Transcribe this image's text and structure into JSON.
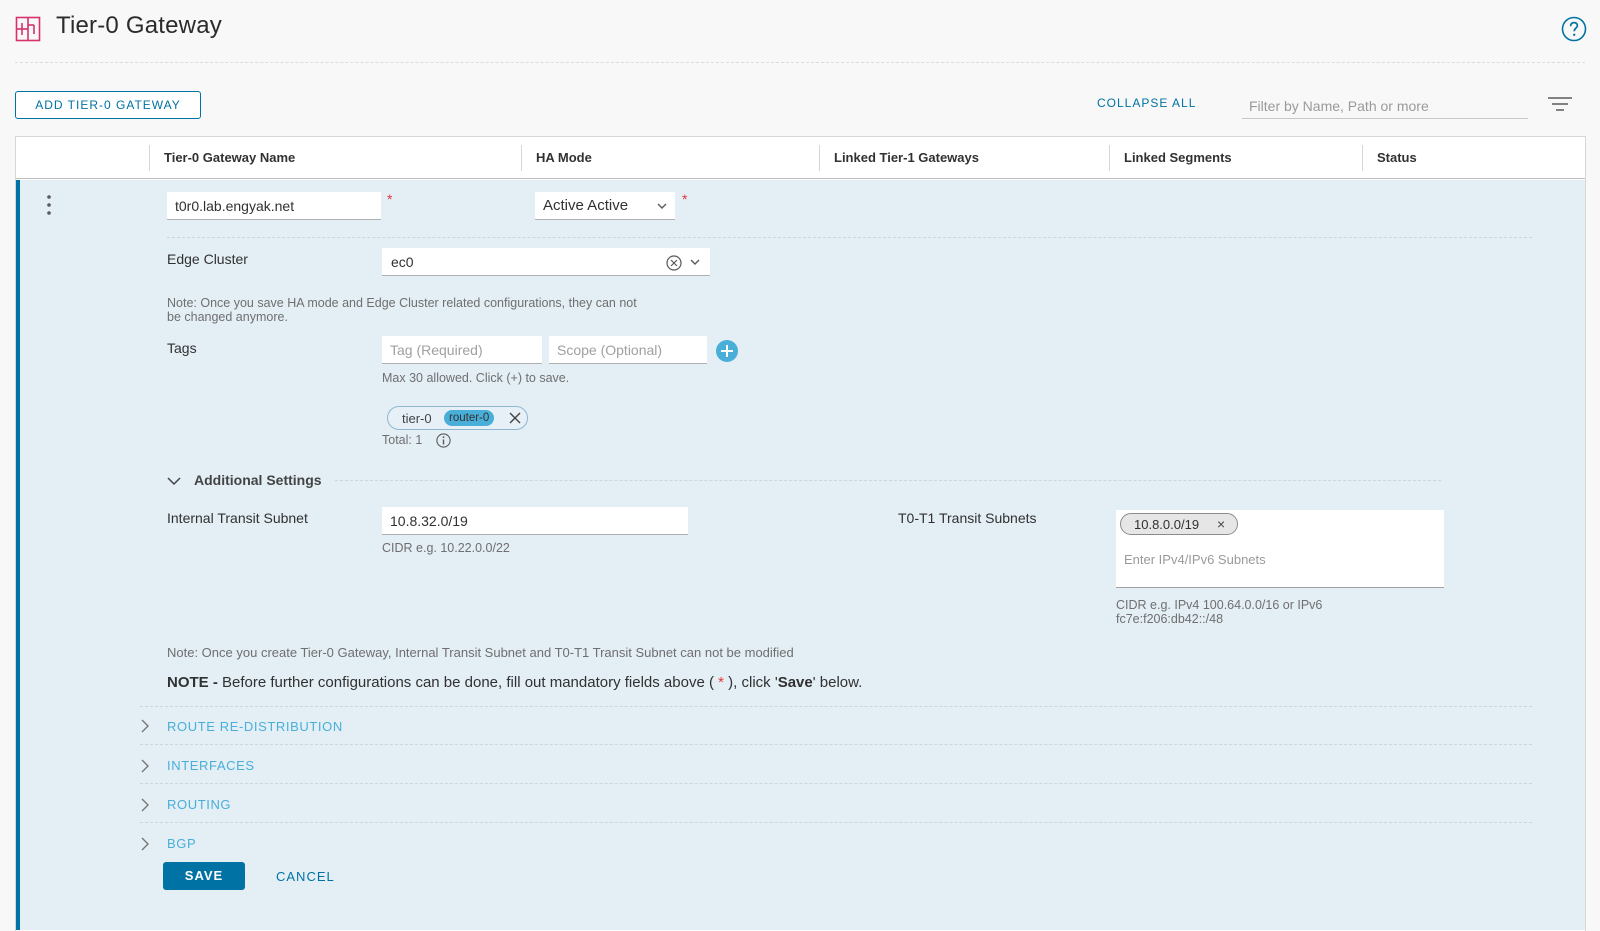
{
  "header": {
    "title": "Tier-0 Gateway",
    "icon": "gateway-icon",
    "help_icon": "help-icon"
  },
  "toolbar": {
    "add_label": "ADD TIER-0 GATEWAY",
    "collapse_label": "COLLAPSE ALL",
    "filter_placeholder": "Filter by Name, Path or more"
  },
  "grid": {
    "columns": [
      "Tier-0 Gateway Name",
      "HA Mode",
      "Linked Tier-1 Gateways",
      "Linked Segments",
      "Status"
    ]
  },
  "edit_row": {
    "name_value": "t0r0.lab.engyak.net",
    "ha_mode_value": "Active Active",
    "required_mark": "*",
    "edge_cluster_label": "Edge Cluster",
    "edge_cluster_value": "ec0",
    "ha_note_line1": "Note: Once you save HA mode and Edge Cluster related configurations, they can not",
    "ha_note_line2": "be changed anymore.",
    "tags_label": "Tags",
    "tag_placeholder": "Tag (Required)",
    "scope_placeholder": "Scope (Optional)",
    "tags_hint": "Max 30 allowed. Click (+) to save.",
    "tag_chip_tag": "tier-0",
    "tag_chip_scope": "router-0",
    "tags_total": "Total: 1",
    "additional_settings_label": "Additional Settings",
    "internal_transit_label": "Internal Transit Subnet",
    "internal_transit_value": "10.8.32.0/19",
    "internal_transit_hint": "CIDR e.g. 10.22.0.0/22",
    "t0t1_label": "T0-T1 Transit Subnets",
    "t0t1_chip": "10.8.0.0/19",
    "t0t1_placeholder": "Enter IPv4/IPv6 Subnets",
    "t0t1_hint_line1": "CIDR e.g. IPv4 100.64.0.0/16 or IPv6",
    "t0t1_hint_line2": "fc7e:f206:db42::/48",
    "create_note": "Note: Once you create Tier-0 Gateway, Internal Transit Subnet and T0-T1 Transit Subnet can not be modified",
    "mandatory_note_bold": "NOTE -",
    "mandatory_note_part1": " Before further configurations can be done, fill out mandatory fields above ( ",
    "mandatory_note_star": "*",
    "mandatory_note_part2": " ), click '",
    "mandatory_note_save": "Save",
    "mandatory_note_part3": "' below.",
    "sections": [
      "ROUTE RE-DISTRIBUTION",
      "INTERFACES",
      "ROUTING",
      "BGP"
    ],
    "save_label": "SAVE",
    "cancel_label": "CANCEL"
  },
  "colors": {
    "primary": "#0072a3",
    "light_link": "#49afd9",
    "row_bg": "#e4eef5",
    "required": "#e0393e",
    "title_icon": "#d6336c"
  }
}
